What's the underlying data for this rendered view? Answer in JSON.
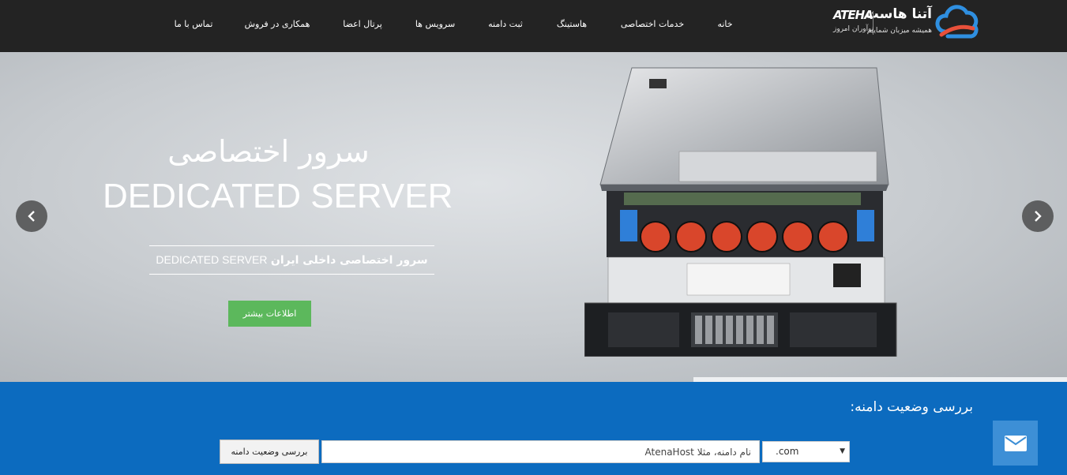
{
  "brand": {
    "name_fa": "آتنا هاست",
    "mark": "ATEHA",
    "slogan_fa": "همیشه میزبان شماییم",
    "tagline_fa": "نوآوران امروز"
  },
  "nav": {
    "items": [
      {
        "label": "خانه"
      },
      {
        "label": "خدمات اختصاصی"
      },
      {
        "label": "هاستینگ"
      },
      {
        "label": "ثبت دامنه"
      },
      {
        "label": "سرویس ها"
      },
      {
        "label": "پرتال اعضا"
      },
      {
        "label": "همکاری در فروش"
      },
      {
        "label": "تماس با ما"
      }
    ]
  },
  "hero": {
    "title_fa": "سرور اختصاصی",
    "title_en": "DEDICATED SERVER",
    "subtitle_fa": "سرور اختصاصی داخلی ایران",
    "subtitle_en": "DEDICATED SERVER",
    "button_label": "اطلاعات بیشتر",
    "prev_icon": "chevron-left-icon",
    "next_icon": "chevron-right-icon"
  },
  "domain_check": {
    "title": "بررسی وضعیت دامنه:",
    "button_label": "بررسی وضعیت دامنه",
    "input_placeholder": "نام دامنه، مثلا AtenaHost",
    "tld_selected": ".com"
  },
  "colors": {
    "topbar": "#232323",
    "domain_bg": "#0c6bbf",
    "button_green": "#5cb85c",
    "fab": "#3d8fd6"
  },
  "icons": {
    "logo": "cloud-logo-icon",
    "contact": "envelope-icon"
  }
}
